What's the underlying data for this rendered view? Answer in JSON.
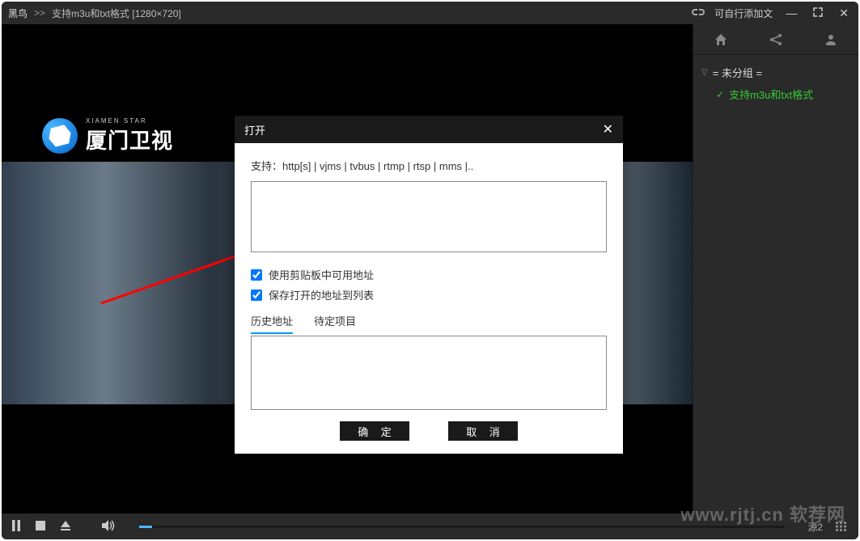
{
  "titlebar": {
    "app_name": "黑鸟",
    "arrows": ">>",
    "detail": "支持m3u和txt格式  [1280×720]",
    "right_text": "可自行添加文"
  },
  "logo": {
    "sub": "XIAMEN STAR",
    "text": "厦门卫视"
  },
  "sidebar": {
    "group_name": "= 未分组 =",
    "channel": "支持m3u和txt格式"
  },
  "bottombar": {
    "source": "源2"
  },
  "dialog": {
    "title": "打开",
    "support": "支持：http[s] | vjms | tvbus | rtmp | rtsp | mms |..",
    "check1": "使用剪贴板中可用地址",
    "check2": "保存打开的地址到列表",
    "tab_history": "历史地址",
    "tab_pending": "待定项目",
    "ok": "确 定",
    "cancel": "取 消"
  },
  "watermark": "www.rjtj.cn 软荐网"
}
